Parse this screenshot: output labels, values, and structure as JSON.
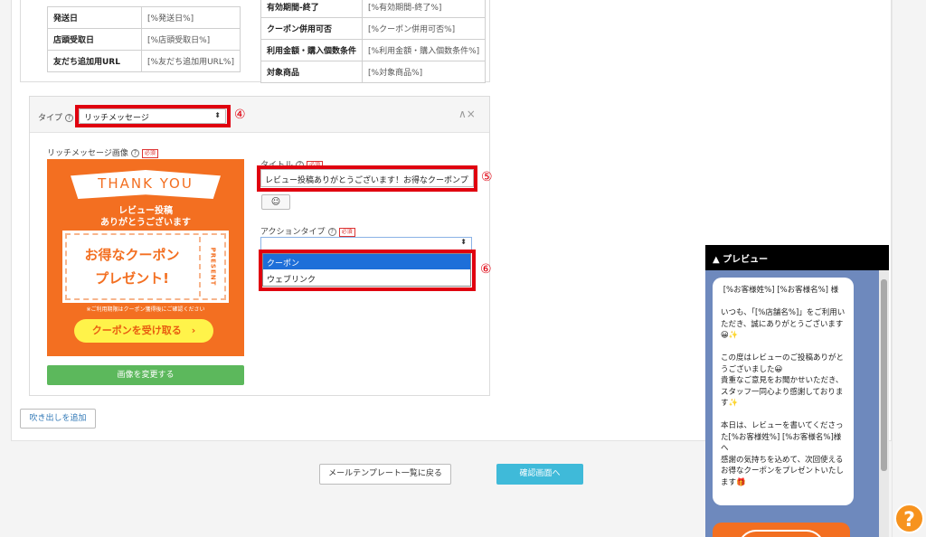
{
  "variables_left": [
    {
      "key": "発送日",
      "value": "[%発送日%]"
    },
    {
      "key": "店頭受取日",
      "value": "[%店頭受取日%]"
    },
    {
      "key": "友だち追加用URL",
      "value": "[%友だち追加用URL%]"
    }
  ],
  "variables_right": [
    {
      "key": "有効期間-終了",
      "value": "[%有効期間-終了%]"
    },
    {
      "key": "クーポン併用可否",
      "value": "[%クーポン併用可否%]"
    },
    {
      "key": "利用金額・購入個数条件",
      "value": "[%利用金額・購入個数条件%]"
    },
    {
      "key": "対象商品",
      "value": "[%対象商品%]"
    }
  ],
  "bubble": {
    "type_label": "タイプ",
    "type_help": "?",
    "type_value": "リッチメッセージ",
    "caret": "⬍",
    "controls": "∧×",
    "marker_type": "④",
    "marker_title": "⑤",
    "marker_action": "⑥",
    "image_label": "リッチメッセージ画像",
    "required": "必須",
    "image": {
      "thank_you": "THANK YOU",
      "line1": "レビュー投稿",
      "line2": "ありがとうございます",
      "coupon1": "お得なクーポン",
      "coupon2": "プレゼント!",
      "present": "PRESENT",
      "notice": "※ご利用期限はクーポン獲得後にご確認ください",
      "button": "クーポンを受け取る　›"
    },
    "change_image": "画像を変更する",
    "title_label": "タイトル",
    "title_value": "レビュー投稿ありがとうございます！お得なクーポンプ",
    "emoji": "☺",
    "action_label": "アクションタイプ",
    "action_options": [
      "クーポン",
      "ウェブリンク"
    ]
  },
  "buttons": {
    "add_bubble": "吹き出しを追加",
    "back": "メールテンプレート一覧に戻る",
    "confirm": "確認画面へ"
  },
  "preview": {
    "header": "▲ プレビュー",
    "message": " [%お客様姓%] [%お客様名%] 様\n\nいつも、「[%店舗名%]」をご利用いただき、誠にありがとうございます😀✨\n\nこの度はレビューのご投稿ありがとうございました😀\n貴重なご意見をお聞かせいただき、スタッフ一同心より感謝しております✨\n\n本日は、レビューを書いてくださった[%お客様姓%] [%お客様名%]様へ\n感謝の気持ちを込めて、次回使えるお得なクーポンをプレゼントいたします🎁"
  },
  "help": "?"
}
